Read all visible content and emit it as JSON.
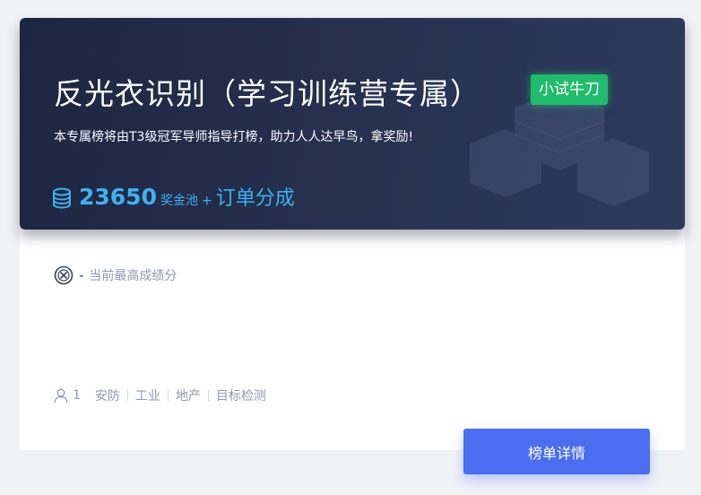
{
  "banner": {
    "title": "反光衣识别（学习训练营专属）",
    "level_badge": "小试牛刀",
    "subtitle": "本专属榜将由T3级冠军导师指导打榜，助力人人达早鸟，拿奖励!",
    "prize": {
      "amount": "23650",
      "label": "奖金池",
      "plus": "+",
      "extra": "订单分成"
    },
    "colors": {
      "accent": "#3fb1f0",
      "badge": "#21bb6e"
    }
  },
  "score": {
    "icon": "no-score-icon",
    "value": "-",
    "label": "当前最高成绩分"
  },
  "meta": {
    "participants": "1",
    "tags": [
      "安防",
      "工业",
      "地产",
      "目标检测"
    ]
  },
  "actions": {
    "detail_label": "榜单详情",
    "color": "#4b6ef0"
  }
}
